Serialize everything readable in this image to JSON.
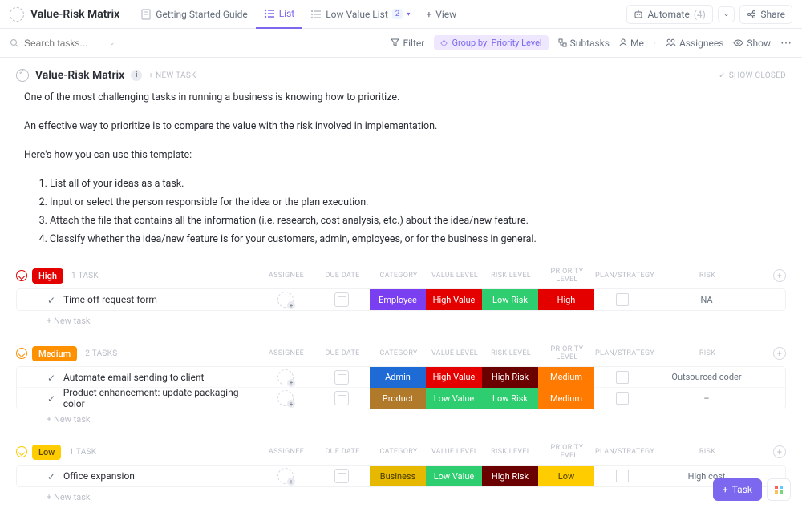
{
  "header": {
    "title": "Value-Risk Matrix",
    "tabs": {
      "getting_started": "Getting Started Guide",
      "list": "List",
      "low_value": "Low Value List",
      "low_value_badge": "2",
      "view": "View"
    },
    "automate_label": "Automate",
    "automate_count": "(4)",
    "share_label": "Share"
  },
  "filterbar": {
    "search_placeholder": "Search tasks...",
    "filter": "Filter",
    "groupby": "Group by: Priority Level",
    "subtasks": "Subtasks",
    "me": "Me",
    "assignees": "Assignees",
    "show": "Show"
  },
  "list": {
    "title": "Value-Risk Matrix",
    "new_task": "+ NEW TASK",
    "show_closed": "SHOW CLOSED"
  },
  "description": {
    "p1": "One of the most challenging tasks in running a business is knowing how to prioritize.",
    "p2": "An effective way to prioritize is to compare the value with the risk involved in implementation.",
    "p3": "Here's how you can use this template:",
    "li1": "List all of your ideas as a task.",
    "li2": "Input or select the person responsible for the idea or the plan execution.",
    "li3": "Attach the file that contains all the information (i.e. research, cost analysis, etc.) about the idea/new feature.",
    "li4": "Classify whether the idea/new feature is for your customers, admin, employees, or for the business in general."
  },
  "columns": {
    "assignee": "ASSIGNEE",
    "due_date": "DUE DATE",
    "category": "CATEGORY",
    "value_level": "VALUE LEVEL",
    "risk_level": "RISK LEVEL",
    "priority_level": "PRIORITY LEVEL",
    "plan_strategy": "PLAN/STRATEGY",
    "risk": "RISK"
  },
  "groups": {
    "high": {
      "label": "High",
      "count": "1 TASK"
    },
    "medium": {
      "label": "Medium",
      "count": "2 TASKS"
    },
    "low": {
      "label": "Low",
      "count": "1 TASK"
    }
  },
  "tasks": {
    "high": [
      {
        "name": "Time off request form",
        "category": "Employee",
        "cat_class": "bg-employee",
        "value": "High Value",
        "val_class": "bg-highvalue",
        "risklvl": "Low Risk",
        "rl_class": "bg-lowrisk",
        "priority": "High",
        "pr_class": "bg-priohigh",
        "risk": "NA"
      }
    ],
    "medium": [
      {
        "name": "Automate email sending to client",
        "category": "Admin",
        "cat_class": "bg-admin",
        "value": "High Value",
        "val_class": "bg-highvalue",
        "risklvl": "High Risk",
        "rl_class": "bg-highrisk",
        "priority": "Medium",
        "pr_class": "bg-priomed",
        "risk": "Outsourced coder"
      },
      {
        "name": "Product enhancement: update packaging color",
        "category": "Product",
        "cat_class": "bg-product",
        "value": "Low Value",
        "val_class": "bg-lowvalue",
        "risklvl": "Low Risk",
        "rl_class": "bg-lowrisk",
        "priority": "Medium",
        "pr_class": "bg-priomed",
        "risk": "–"
      }
    ],
    "low": [
      {
        "name": "Office expansion",
        "category": "Business",
        "cat_class": "bg-business",
        "value": "Low Value",
        "val_class": "bg-lowvalue",
        "risklvl": "High Risk",
        "rl_class": "bg-highrisk",
        "priority": "Low",
        "pr_class": "bg-priolow",
        "risk": "High cost"
      }
    ]
  },
  "new_task_line": "+ New task",
  "float": {
    "task": "Task"
  }
}
